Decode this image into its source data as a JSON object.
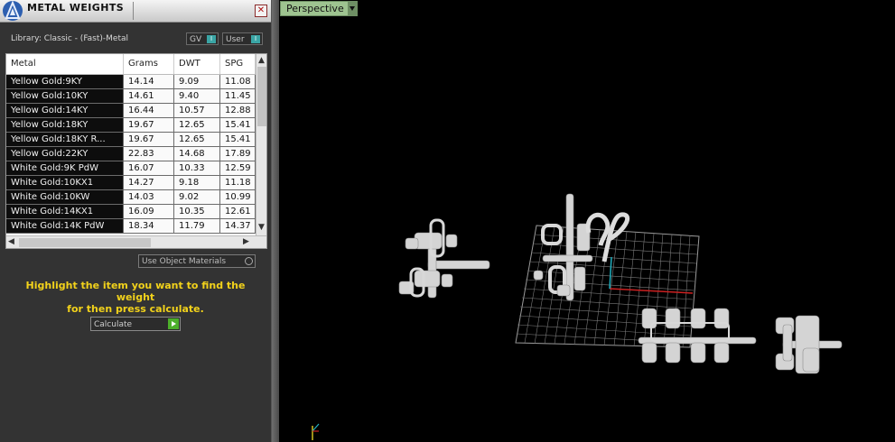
{
  "panel": {
    "title": "METAL WEIGHTS",
    "close_glyph": "✕",
    "library_label": "Library: Classic - (Fast)-Metal",
    "toggle_gv": "GV",
    "toggle_user": "User",
    "knob_glyph": "I",
    "use_object_materials": "Use Object Materials",
    "instruction_line1": "Highlight the item you want to find the weight",
    "instruction_line2": "for then press calculate.",
    "calculate_label": "Calculate"
  },
  "table": {
    "columns": [
      "Metal",
      "Grams",
      "DWT",
      "SPG"
    ],
    "rows": [
      [
        "Yellow Gold:9KY",
        "14.14",
        "9.09",
        "11.08"
      ],
      [
        "Yellow Gold:10KY",
        "14.61",
        "9.40",
        "11.45"
      ],
      [
        "Yellow Gold:14KY",
        "16.44",
        "10.57",
        "12.88"
      ],
      [
        "Yellow Gold:18KY",
        "19.67",
        "12.65",
        "15.41"
      ],
      [
        "Yellow Gold:18KY R...",
        "19.67",
        "12.65",
        "15.41"
      ],
      [
        "Yellow Gold:22KY",
        "22.83",
        "14.68",
        "17.89"
      ],
      [
        "White Gold:9K PdW",
        "16.07",
        "10.33",
        "12.59"
      ],
      [
        "White Gold:10KX1",
        "14.27",
        "9.18",
        "11.18"
      ],
      [
        "White Gold:10KW",
        "14.03",
        "9.02",
        "10.99"
      ],
      [
        "White Gold:14KX1",
        "16.09",
        "10.35",
        "12.61"
      ],
      [
        "White Gold:14K PdW",
        "18.34",
        "11.79",
        "14.37"
      ]
    ],
    "scroll_up": "▲",
    "scroll_down": "▼",
    "scroll_left": "◀",
    "scroll_right": "▶"
  },
  "viewport": {
    "view_label": "Perspective",
    "grid_color": "#808080",
    "axis_x_color": "#cc2020",
    "axis_y_color": "#20b0c0",
    "model_color": "#d8d8d8"
  },
  "icons": {
    "app_logo": "app-logo-icon",
    "close": "close-icon",
    "dropdown": "chevron-down-icon",
    "play": "play-icon",
    "axis_gizmo": "axis-gizmo-icon"
  }
}
